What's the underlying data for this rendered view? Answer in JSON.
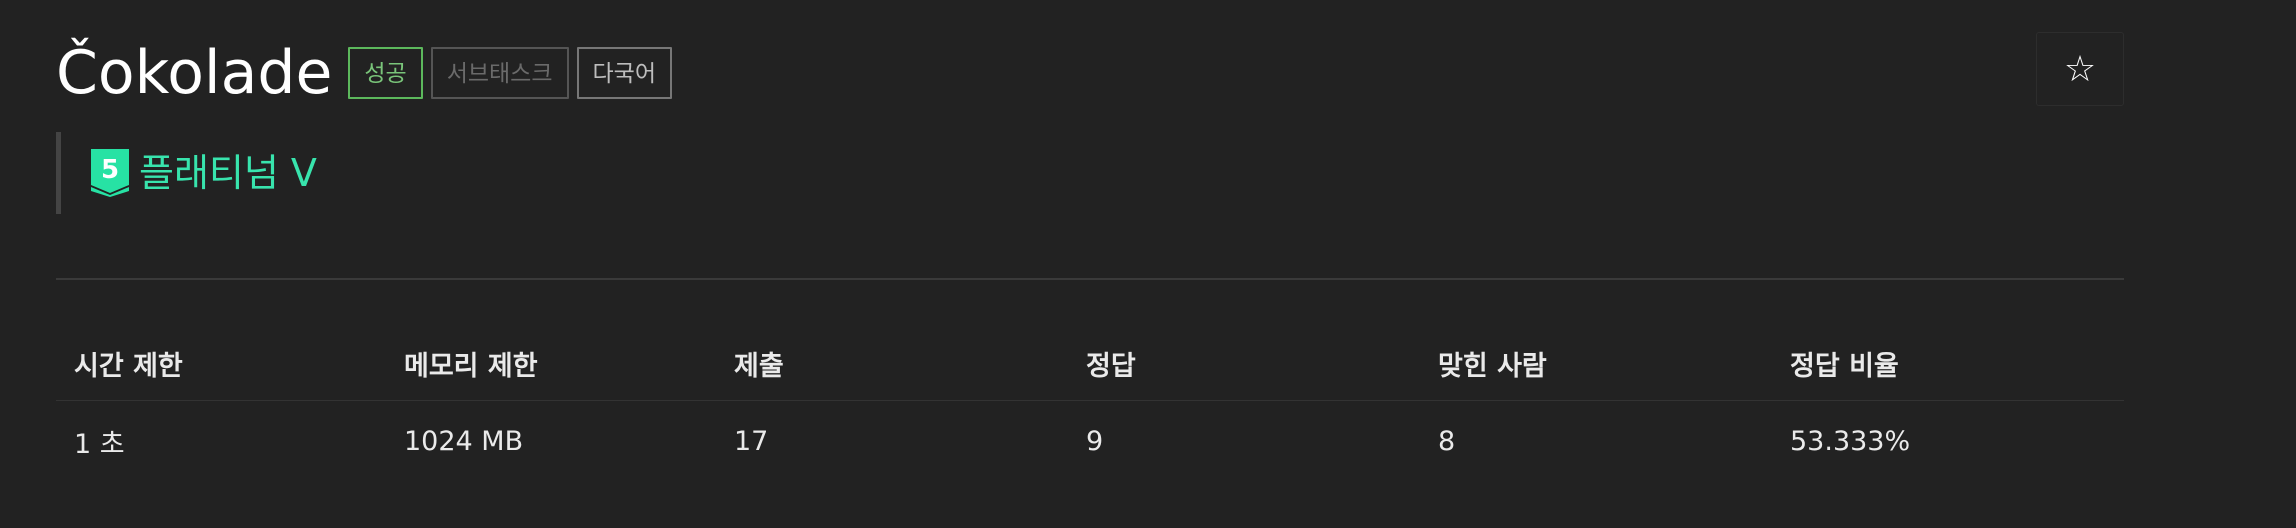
{
  "problem": {
    "title": "Čokolade",
    "tags": {
      "success": "성공",
      "subtask": "서브태스크",
      "multilang": "다국어"
    },
    "star_label": "☆",
    "tier": {
      "number": "5",
      "label": "플래티넘 V",
      "color": "#38e4ad"
    }
  },
  "info": {
    "headers": [
      "시간 제한",
      "메모리 제한",
      "제출",
      "정답",
      "맞힌 사람",
      "정답 비율"
    ],
    "values": [
      "1 초",
      "1024 MB",
      "17",
      "9",
      "8",
      "53.333%"
    ]
  },
  "colors": {
    "background": "#222222",
    "success": "#5cb85c",
    "tier": "#38e4ad"
  }
}
